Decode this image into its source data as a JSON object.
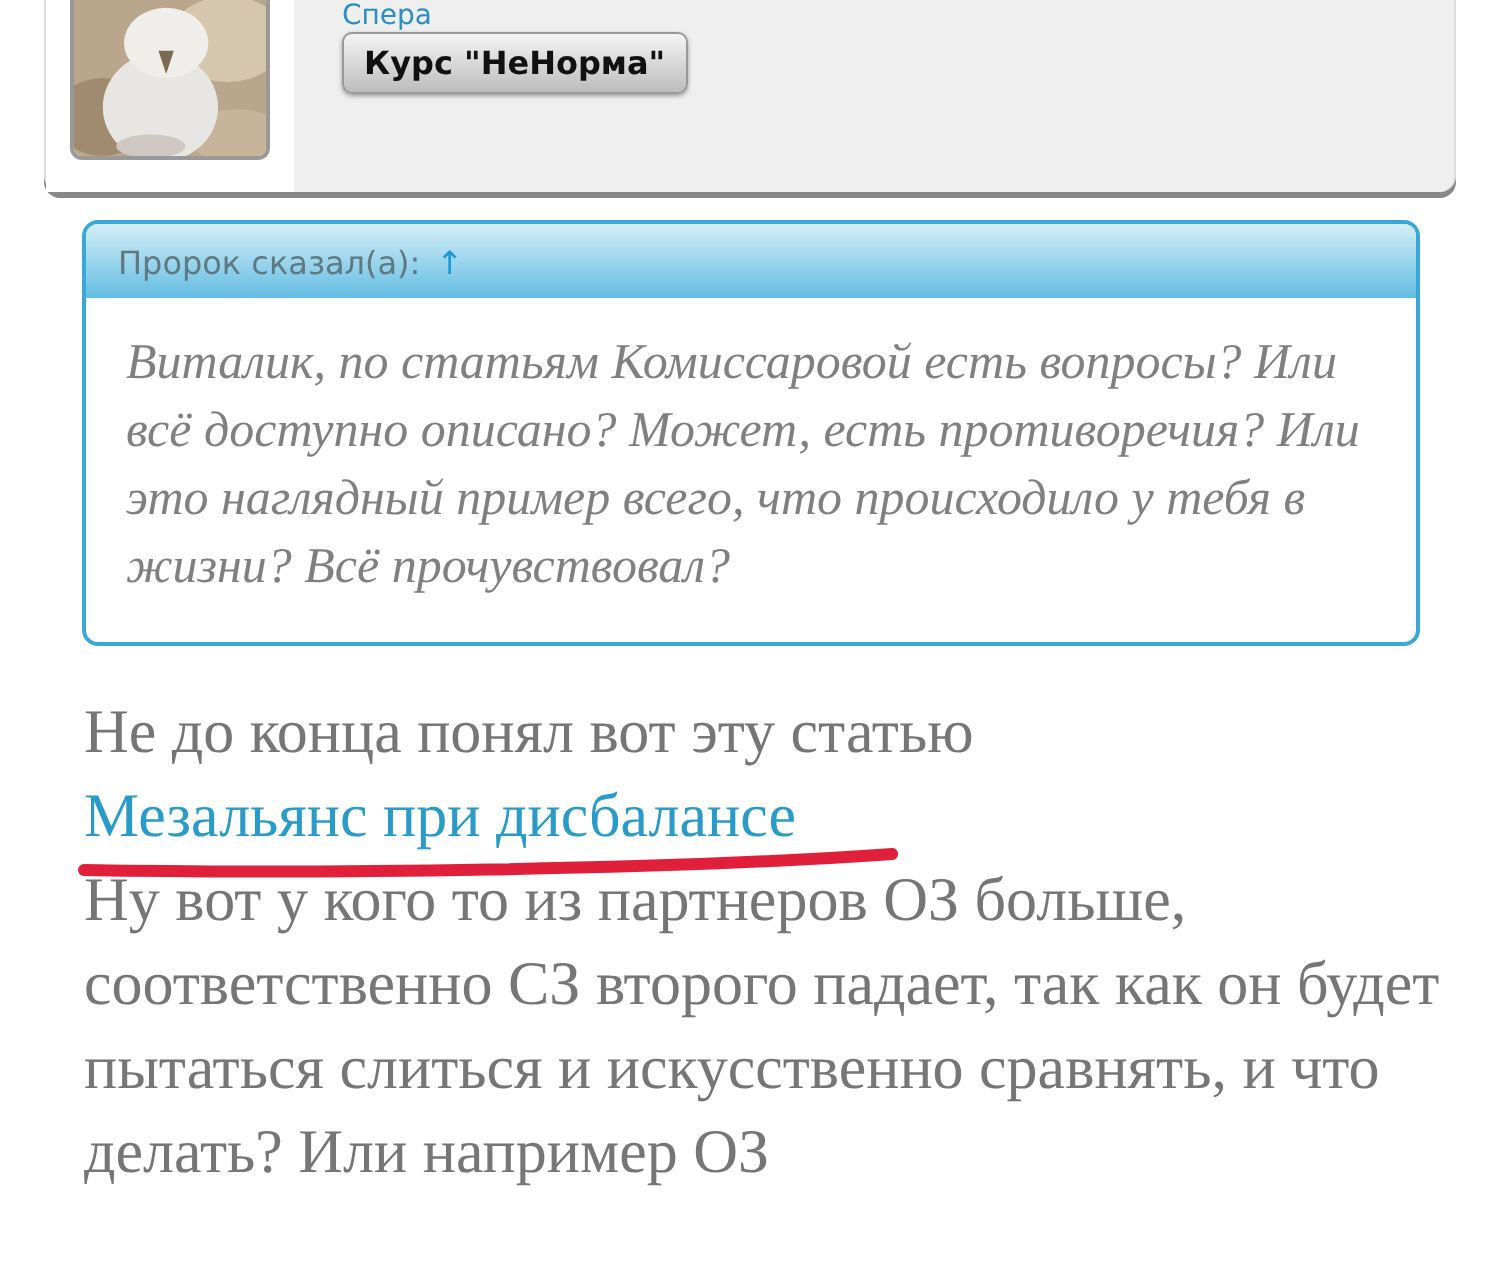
{
  "profile": {
    "name": "Спера",
    "badge": "Курс \"НеНорма\""
  },
  "quote": {
    "author": "Пророк сказал(а):",
    "jump": "↑",
    "text": "Виталик, по статьям Комиссаровой есть вопросы? Или всё доступно описано? Может, есть противоречия? Или это наглядный пример всего, что происходило у тебя в жизни? Всё прочувствовал?"
  },
  "post": {
    "intro": "Не до конца понял вот эту статью",
    "link": {
      "text": "Мезальянс при дисбалансе",
      "highlighted": true
    },
    "body": "Ну вот у кого то из партнеров ОЗ больше, соответственно СЗ второго падает, так как он будет пытаться слиться и искусственно сравнять, и что делать? Или например ОЗ"
  }
}
